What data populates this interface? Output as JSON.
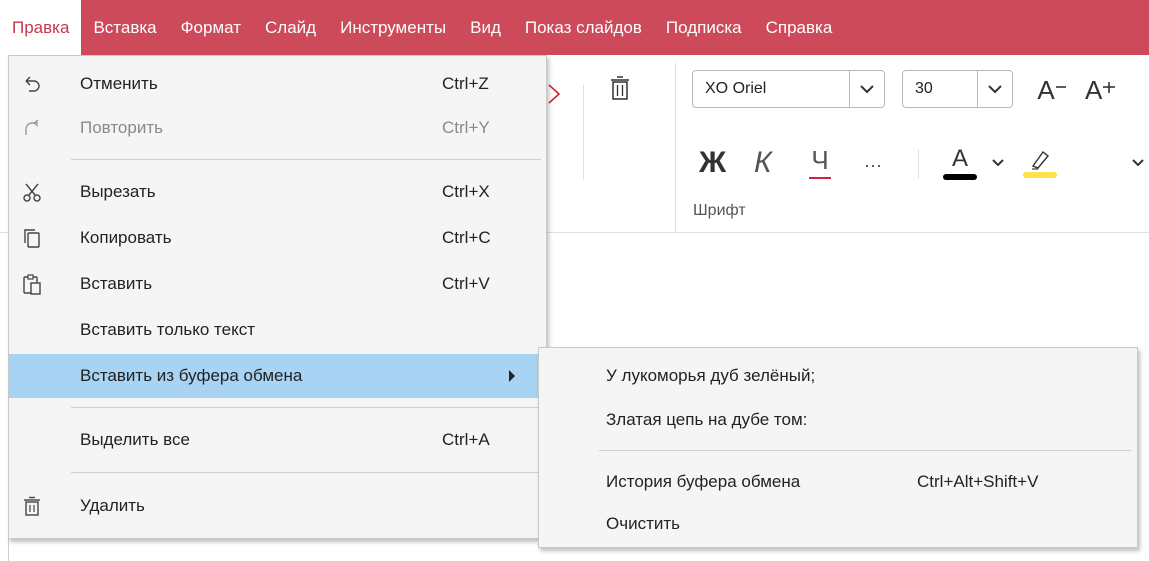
{
  "menubar": {
    "items": [
      "Правка",
      "Вставка",
      "Формат",
      "Слайд",
      "Инструменты",
      "Вид",
      "Показ слайдов",
      "Подписка",
      "Справка"
    ],
    "active": "Правка"
  },
  "ribbon": {
    "font_name": "XO Oriel",
    "font_size": "30",
    "increase_font_label": "A",
    "decrease_font_label": "A",
    "bold_label": "Ж",
    "italic_label": "К",
    "underline_label": "Ч",
    "more_label": "···",
    "font_color_label": "A",
    "group_label": "Шрифт"
  },
  "edit_menu": {
    "undo": {
      "label": "Отменить",
      "shortcut": "Ctrl+Z"
    },
    "redo": {
      "label": "Повторить",
      "shortcut": "Ctrl+Y"
    },
    "cut": {
      "label": "Вырезать",
      "shortcut": "Ctrl+X"
    },
    "copy": {
      "label": "Копировать",
      "shortcut": "Ctrl+C"
    },
    "paste": {
      "label": "Вставить",
      "shortcut": "Ctrl+V"
    },
    "paste_text": {
      "label": "Вставить только текст"
    },
    "paste_from_clipboard": {
      "label": "Вставить из буфера обмена"
    },
    "select_all": {
      "label": "Выделить все",
      "shortcut": "Ctrl+A"
    },
    "delete": {
      "label": "Удалить"
    }
  },
  "clipboard_submenu": {
    "entries": [
      "У лукоморья дуб зелёный;",
      "Златая цепь на дубе том:"
    ],
    "history": {
      "label": "История буфера обмена",
      "shortcut": "Ctrl+Alt+Shift+V"
    },
    "clear": {
      "label": "Очистить"
    }
  },
  "colors": {
    "menubar_bg": "#cc4a5a",
    "highlight": "#a8d3f3",
    "font_color_bar": "#000000",
    "highlighter_bar": "#ffe14a",
    "underline_accent": "#d2233a"
  },
  "icons": {
    "undo": "undo-icon",
    "redo": "redo-icon",
    "cut": "scissors-icon",
    "copy": "copy-icon",
    "paste": "clipboard-icon",
    "delete": "trash-icon",
    "submenu_arrow": "triangle-right-icon"
  }
}
